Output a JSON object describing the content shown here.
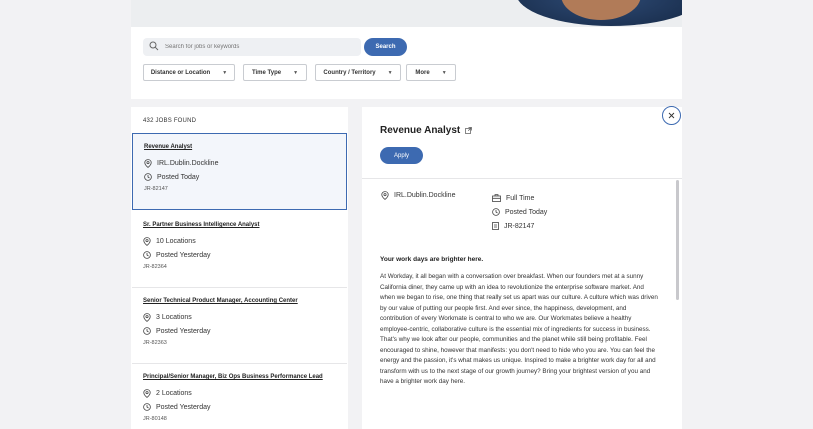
{
  "search": {
    "placeholder": "Search for jobs or keywords",
    "button_label": "Search"
  },
  "filters": [
    {
      "label": "Distance or Location"
    },
    {
      "label": "Time Type"
    },
    {
      "label": "Country / Territory"
    },
    {
      "label": "More"
    }
  ],
  "results": {
    "count_label": "432 JOBS FOUND",
    "jobs": [
      {
        "title": "Revenue Analyst",
        "location": "IRL.Dublin.Dockline",
        "posted": "Posted Today",
        "req_id": "JR-82147"
      },
      {
        "title": "Sr. Partner Business Intelligence Analyst",
        "location": "10 Locations",
        "posted": "Posted Yesterday",
        "req_id": "JR-82364"
      },
      {
        "title": "Senior Technical Product Manager, Accounting Center",
        "location": "3 Locations",
        "posted": "Posted Yesterday",
        "req_id": "JR-82363"
      },
      {
        "title": "Principal/Senior Manager, Biz Ops Business Performance Lead",
        "location": "2 Locations",
        "posted": "Posted Yesterday",
        "req_id": "JR-80148"
      }
    ]
  },
  "detail": {
    "title": "Revenue Analyst",
    "apply_label": "Apply",
    "location": "IRL.Dublin.Dockline",
    "time_type": "Full Time",
    "posted": "Posted Today",
    "req_id": "JR-82147",
    "section_heading": "Your work days are brighter here.",
    "body": "At Workday, it all began with a conversation over breakfast. When our founders met at a sunny California diner, they came up with an idea to revolutionize the enterprise software market. And when we began to rise, one thing that really set us apart was our culture. A culture which was driven by our value of putting our people first. And ever since, the happiness, development, and contribution of every Workmate is central to who we are. Our Workmates believe a healthy employee-centric, collaborative culture is the essential mix of ingredients for success in business. That's why we look after our people, communities and the planet while still being profitable. Feel encouraged to shine, however that manifests: you don't need to hide who you are. You can feel the energy and the passion, it's what makes us unique. Inspired to make a brighter work day for all and transform with us to the next stage of our growth journey? Bring your brightest version of you and have a brighter work day here."
  },
  "colors": {
    "accent": "#3d6ab1",
    "background": "#f2f2f4"
  }
}
